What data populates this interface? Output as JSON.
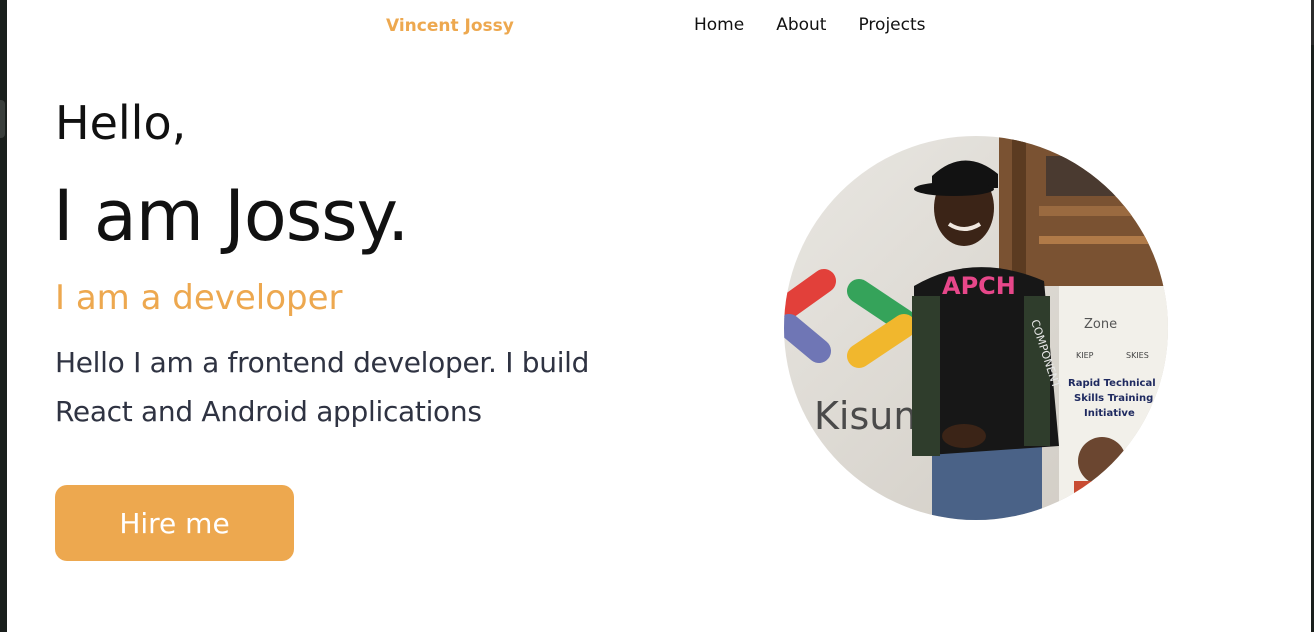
{
  "nav": {
    "brand": "Vincent Jossy",
    "links": [
      "Home",
      "About",
      "Projects"
    ]
  },
  "hero": {
    "greeting": "Hello,",
    "name": "I am Jossy.",
    "role": "I am a developer",
    "description": "Hello I am a frontend developer. I build React and Android applications",
    "cta_label": "Hire me"
  },
  "photo": {
    "shirt_text": "APCH",
    "sleeve_text": "COMPONENT",
    "wall_text": "Kisum",
    "banner_lines": [
      "Zone",
      "KIEP",
      "SKIES",
      "Rapid Technical",
      "Skills Training",
      "Initiative"
    ]
  },
  "colors": {
    "accent": "#eda84f",
    "text": "#111111",
    "body_text": "#2f3342",
    "background": "#ffffff"
  }
}
